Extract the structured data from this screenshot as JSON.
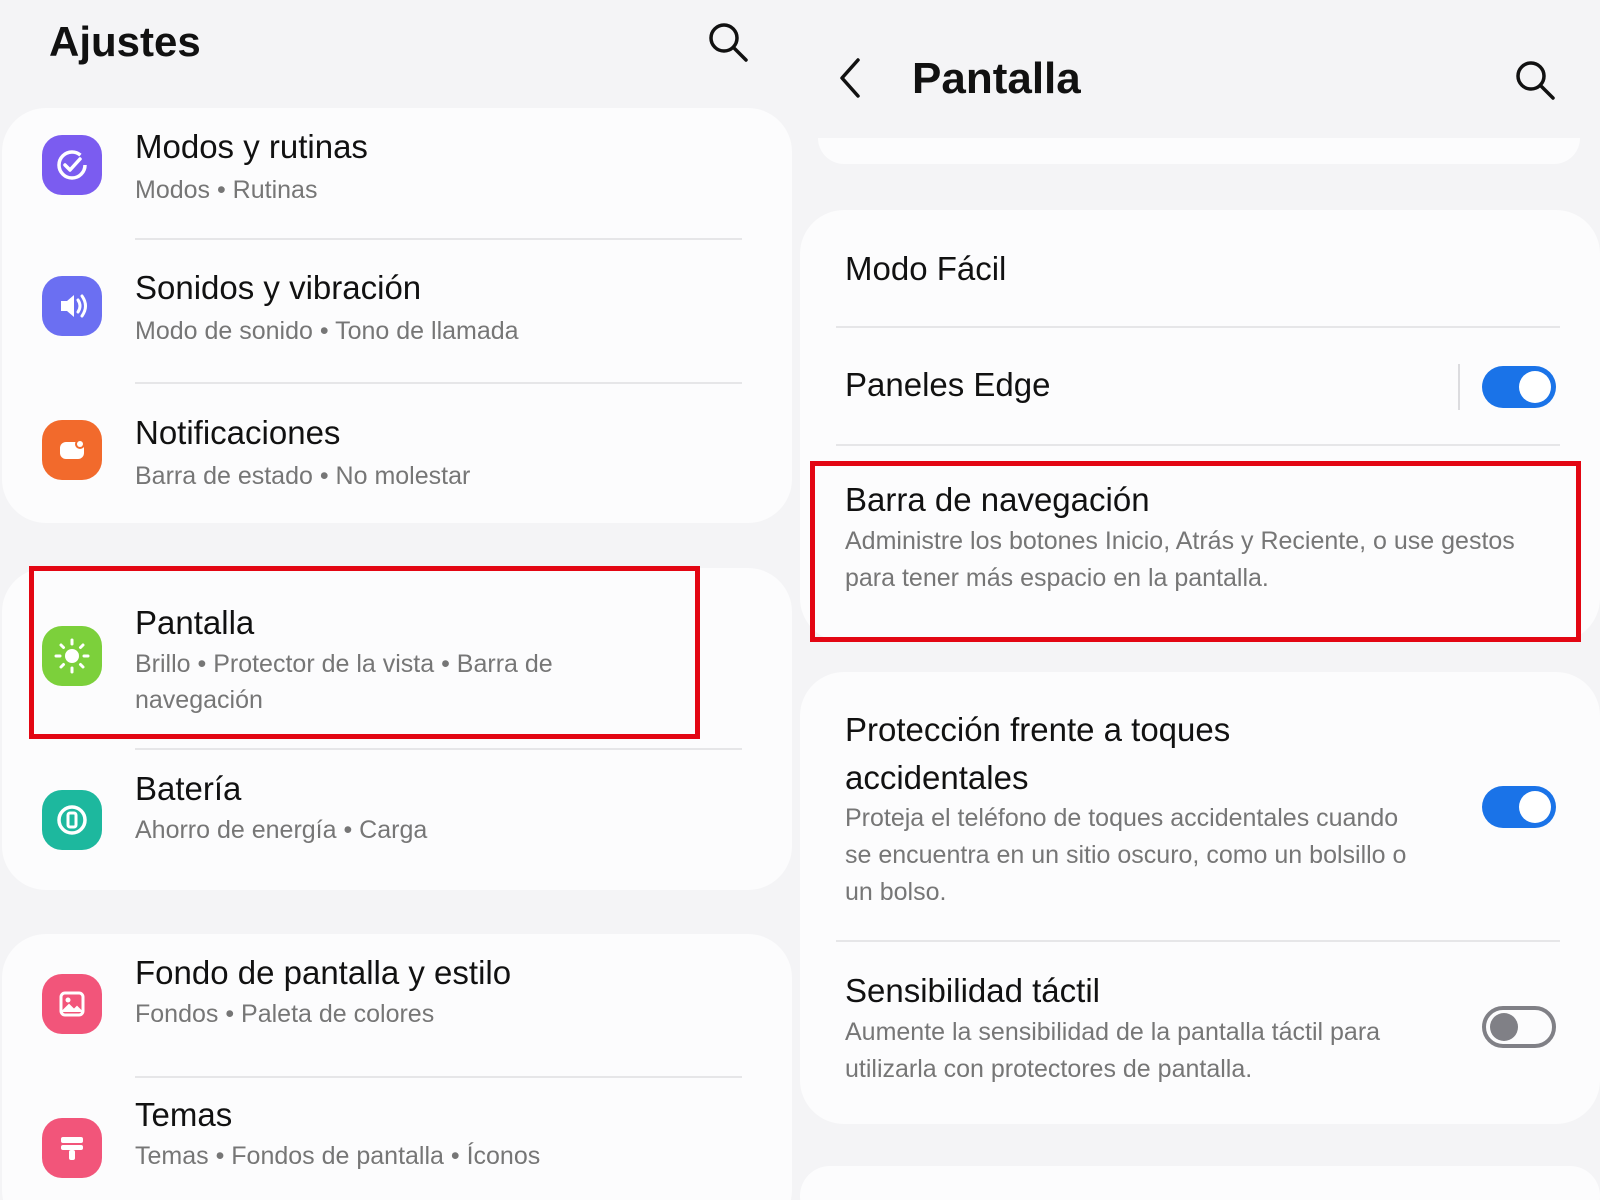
{
  "left": {
    "title": "Ajustes",
    "items": [
      {
        "title": "Modos y rutinas",
        "subtitle": "Modos  •  Rutinas",
        "icon": "check-circle-icon",
        "color": "#7b5cf0"
      },
      {
        "title": "Sonidos y vibración",
        "subtitle": "Modo de sonido  •  Tono de llamada",
        "icon": "speaker-icon",
        "color": "#6b6ff2"
      },
      {
        "title": "Notificaciones",
        "subtitle": "Barra de estado  •  No molestar",
        "icon": "notification-icon",
        "color": "#f26a2c"
      },
      {
        "title": "Pantalla",
        "subtitle": "Brillo  •  Protector de la vista  •  Barra de navegación",
        "icon": "sun-icon",
        "color": "#7cd03b"
      },
      {
        "title": "Batería",
        "subtitle": "Ahorro de energía  •  Carga",
        "icon": "battery-icon",
        "color": "#1db89e"
      },
      {
        "title": "Fondo de pantalla y estilo",
        "subtitle": "Fondos  •  Paleta de colores",
        "icon": "image-icon",
        "color": "#f2557a"
      },
      {
        "title": "Temas",
        "subtitle": "Temas  •  Fondos de pantalla  •  Íconos",
        "icon": "brush-icon",
        "color": "#f2557a"
      }
    ]
  },
  "right": {
    "title": "Pantalla",
    "items": [
      {
        "title": "Modo Fácil"
      },
      {
        "title": "Paneles Edge",
        "toggle": true
      },
      {
        "title": "Barra de navegación",
        "subtitle": "Administre los botones Inicio, Atrás y Reciente, o use gestos para tener más espacio en la pantalla."
      },
      {
        "title": "Protección frente a toques accidentales",
        "subtitle": "Proteja el teléfono de toques accidentales cuando se encuentra en un sitio oscuro, como un bolsillo o un bolso.",
        "toggle": true
      },
      {
        "title": "Sensibilidad táctil",
        "subtitle": "Aumente la sensibilidad de la pantalla táctil para utilizarla con protectores de pantalla.",
        "toggle": false
      }
    ]
  },
  "highlight_color": "#e30613",
  "toggle_on_color": "#1a73e8"
}
